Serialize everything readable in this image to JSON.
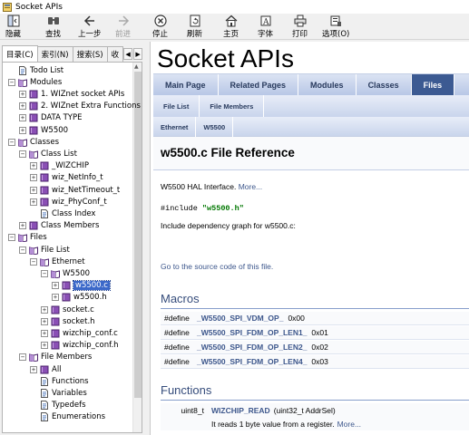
{
  "window": {
    "title": "Socket APIs"
  },
  "toolbar": [
    {
      "label": "隐藏",
      "icon": "hide-icon",
      "disabled": false
    },
    {
      "label": "查找",
      "icon": "find-icon",
      "disabled": false
    },
    {
      "label": "上一步",
      "icon": "back-arrow-icon",
      "disabled": false
    },
    {
      "label": "前进",
      "icon": "forward-arrow-icon",
      "disabled": true
    },
    {
      "label": "停止",
      "icon": "stop-icon",
      "disabled": false
    },
    {
      "label": "刷新",
      "icon": "refresh-icon",
      "disabled": false
    },
    {
      "label": "主页",
      "icon": "home-icon",
      "disabled": false
    },
    {
      "label": "字体",
      "icon": "font-icon",
      "disabled": false
    },
    {
      "label": "打印",
      "icon": "print-icon",
      "disabled": false
    },
    {
      "label": "选项(O)",
      "icon": "options-icon",
      "disabled": false
    }
  ],
  "sidebar": {
    "tabs": [
      "目录(C)",
      "索引(N)",
      "搜索(S)",
      "收"
    ],
    "tree": [
      {
        "label": "Todo List",
        "exp": "",
        "icon": "page",
        "indent": 0
      },
      {
        "label": "Modules",
        "exp": "-",
        "icon": "book-open",
        "indent": 0
      },
      {
        "label": "1. WIZnet socket APIs",
        "exp": "+",
        "icon": "book",
        "indent": 1
      },
      {
        "label": "2. WIZnet Extra Functions",
        "exp": "+",
        "icon": "book",
        "indent": 1
      },
      {
        "label": "DATA TYPE",
        "exp": "+",
        "icon": "book",
        "indent": 1
      },
      {
        "label": "W5500",
        "exp": "+",
        "icon": "book",
        "indent": 1
      },
      {
        "label": "Classes",
        "exp": "-",
        "icon": "book-open",
        "indent": 0
      },
      {
        "label": "Class List",
        "exp": "-",
        "icon": "book-open",
        "indent": 1
      },
      {
        "label": "_WIZCHIP",
        "exp": "+",
        "icon": "book",
        "indent": 2
      },
      {
        "label": "wiz_NetInfo_t",
        "exp": "+",
        "icon": "book",
        "indent": 2
      },
      {
        "label": "wiz_NetTimeout_t",
        "exp": "+",
        "icon": "book",
        "indent": 2
      },
      {
        "label": "wiz_PhyConf_t",
        "exp": "+",
        "icon": "book",
        "indent": 2
      },
      {
        "label": "Class Index",
        "exp": "",
        "icon": "page",
        "indent": 2
      },
      {
        "label": "Class Members",
        "exp": "+",
        "icon": "book",
        "indent": 1
      },
      {
        "label": "Files",
        "exp": "-",
        "icon": "book-open",
        "indent": 0
      },
      {
        "label": "File List",
        "exp": "-",
        "icon": "book-open",
        "indent": 1
      },
      {
        "label": "Ethernet",
        "exp": "-",
        "icon": "book-open",
        "indent": 2
      },
      {
        "label": "W5500",
        "exp": "-",
        "icon": "book-open",
        "indent": 3
      },
      {
        "label": "w5500.c",
        "exp": "+",
        "icon": "book",
        "indent": 4,
        "selected": true
      },
      {
        "label": "w5500.h",
        "exp": "+",
        "icon": "book",
        "indent": 4
      },
      {
        "label": "socket.c",
        "exp": "+",
        "icon": "book",
        "indent": 3
      },
      {
        "label": "socket.h",
        "exp": "+",
        "icon": "book",
        "indent": 3
      },
      {
        "label": "wizchip_conf.c",
        "exp": "+",
        "icon": "book",
        "indent": 3
      },
      {
        "label": "wizchip_conf.h",
        "exp": "+",
        "icon": "book",
        "indent": 3
      },
      {
        "label": "File Members",
        "exp": "-",
        "icon": "book-open",
        "indent": 1
      },
      {
        "label": "All",
        "exp": "+",
        "icon": "book",
        "indent": 2
      },
      {
        "label": "Functions",
        "exp": "",
        "icon": "page",
        "indent": 2
      },
      {
        "label": "Variables",
        "exp": "",
        "icon": "page",
        "indent": 2
      },
      {
        "label": "Typedefs",
        "exp": "",
        "icon": "page",
        "indent": 2
      },
      {
        "label": "Enumerations",
        "exp": "",
        "icon": "page",
        "indent": 2
      }
    ]
  },
  "content": {
    "project_title": "Socket APIs",
    "nav_main": [
      "Main Page",
      "Related Pages",
      "Modules",
      "Classes",
      "Files"
    ],
    "nav_current": "Files",
    "nav_sub": [
      "File List",
      "File Members"
    ],
    "breadcrumb": [
      "Ethernet",
      "W5500"
    ],
    "page_heading": "w5500.c File Reference",
    "brief": "W5500 HAL Interface.",
    "more": "More...",
    "include_kw": "#include",
    "include_file": "\"w5500.h\"",
    "dependency": "Include dependency graph for w5500.c:",
    "source_link": "Go to the source code of this file.",
    "macros_heading": "Macros",
    "macros": [
      {
        "kw": "#define",
        "name": "_W5500_SPI_VDM_OP_",
        "value": "0x00"
      },
      {
        "kw": "#define",
        "name": "_W5500_SPI_FDM_OP_LEN1_",
        "value": "0x01"
      },
      {
        "kw": "#define",
        "name": "_W5500_SPI_FDM_OP_LEN2_",
        "value": "0x02"
      },
      {
        "kw": "#define",
        "name": "_W5500_SPI_FDM_OP_LEN4_",
        "value": "0x03"
      }
    ],
    "functions_heading": "Functions",
    "functions": [
      {
        "type": "uint8_t",
        "name": "WIZCHIP_READ",
        "args": "(uint32_t AddrSel)",
        "desc": "It reads 1 byte value from a register.",
        "more": "More..."
      }
    ]
  }
}
